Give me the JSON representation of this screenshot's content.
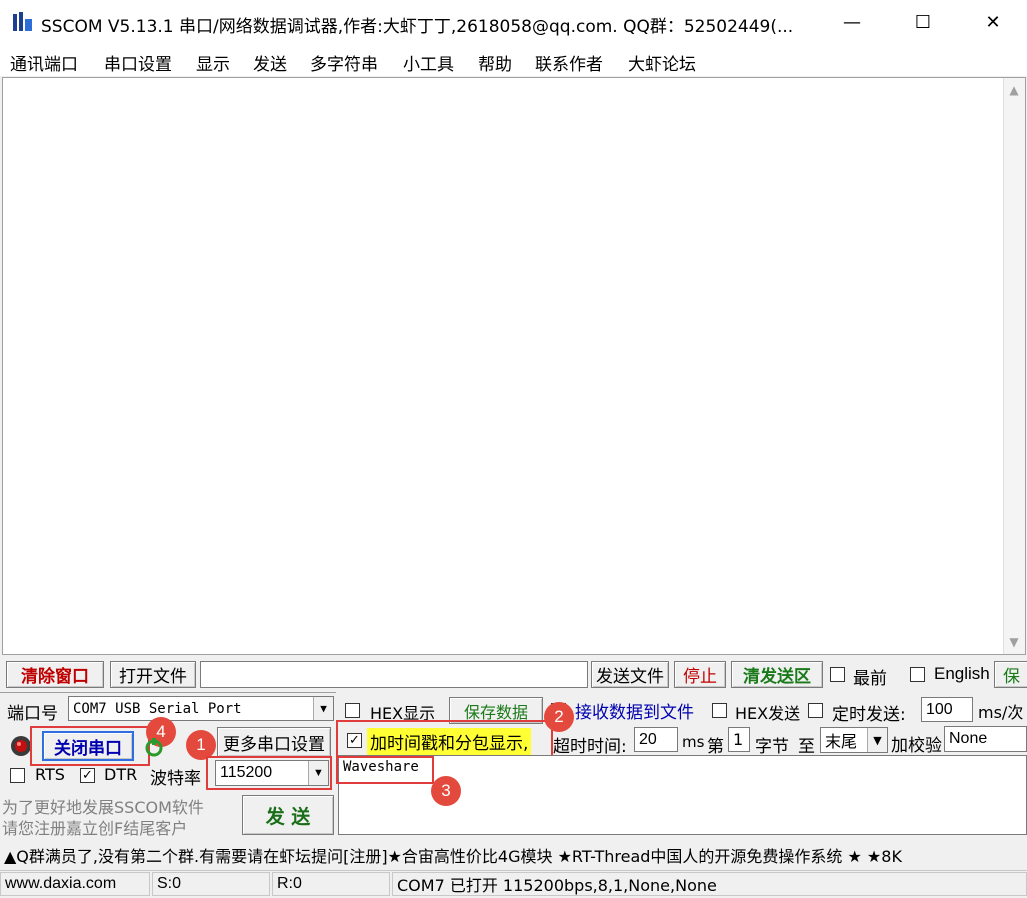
{
  "window": {
    "title": "SSCOM V5.13.1 串口/网络数据调试器,作者:大虾丁丁,2618058@qq.com. QQ群：52502449(...",
    "minimize": "—",
    "maximize": "☐",
    "close": "✕"
  },
  "menu": [
    "通讯端口",
    "串口设置",
    "显示",
    "发送",
    "多字符串",
    "小工具",
    "帮助",
    "联系作者",
    "大虾论坛"
  ],
  "toolbar1": {
    "clear_window": "清除窗口",
    "open_file": "打开文件",
    "send_file": "发送文件",
    "stop": "停止",
    "clear_send": "清发送区",
    "topmost": "最前",
    "english": "English",
    "save_cut": "保"
  },
  "port": {
    "label": "端口号",
    "value": "COM7 USB Serial Port",
    "close_port": "关闭串口",
    "more_settings": "更多串口设置",
    "rts": "RTS",
    "dtr": "DTR",
    "baud_label": "波特率",
    "baud_value": "115200",
    "promo_line1": "为了更好地发展SSCOM软件",
    "promo_line2": "请您注册嘉立创F结尾客户",
    "send": "发  送"
  },
  "options": {
    "hex_display": "HEX显示",
    "save_data": "保存数据",
    "recv_to_file": "接收数据到文件",
    "hex_send": "HEX发送",
    "timed_send": "定时发送:",
    "timed_value": "100",
    "timed_unit": "ms/次",
    "timestamp": "加时间戳和分包显示,",
    "timeout_label": "超时时间:",
    "timeout_value": "20",
    "timeout_unit": "ms",
    "byte_prefix": "第",
    "byte_value": "1",
    "byte_suffix": "字节",
    "to": "至",
    "end_value": "末尾",
    "checksum_label": "加校验",
    "checksum_value": "None"
  },
  "send_text": "Waveshare",
  "badges": [
    "1",
    "2",
    "3",
    "4"
  ],
  "ticker": "▲Q群满员了,没有第二个群.有需要请在虾坛提问[注册]★合宙高性价比4G模块 ★RT-Thread中国人的开源免费操作系统 ★ ★8K",
  "status": {
    "site": "www.daxia.com",
    "sent": "S:0",
    "recv": "R:0",
    "port_state": "COM7 已打开  115200bps,8,1,None,None"
  },
  "colors": {
    "annotation": "#e03c3c",
    "highlight": "#ffff33"
  }
}
